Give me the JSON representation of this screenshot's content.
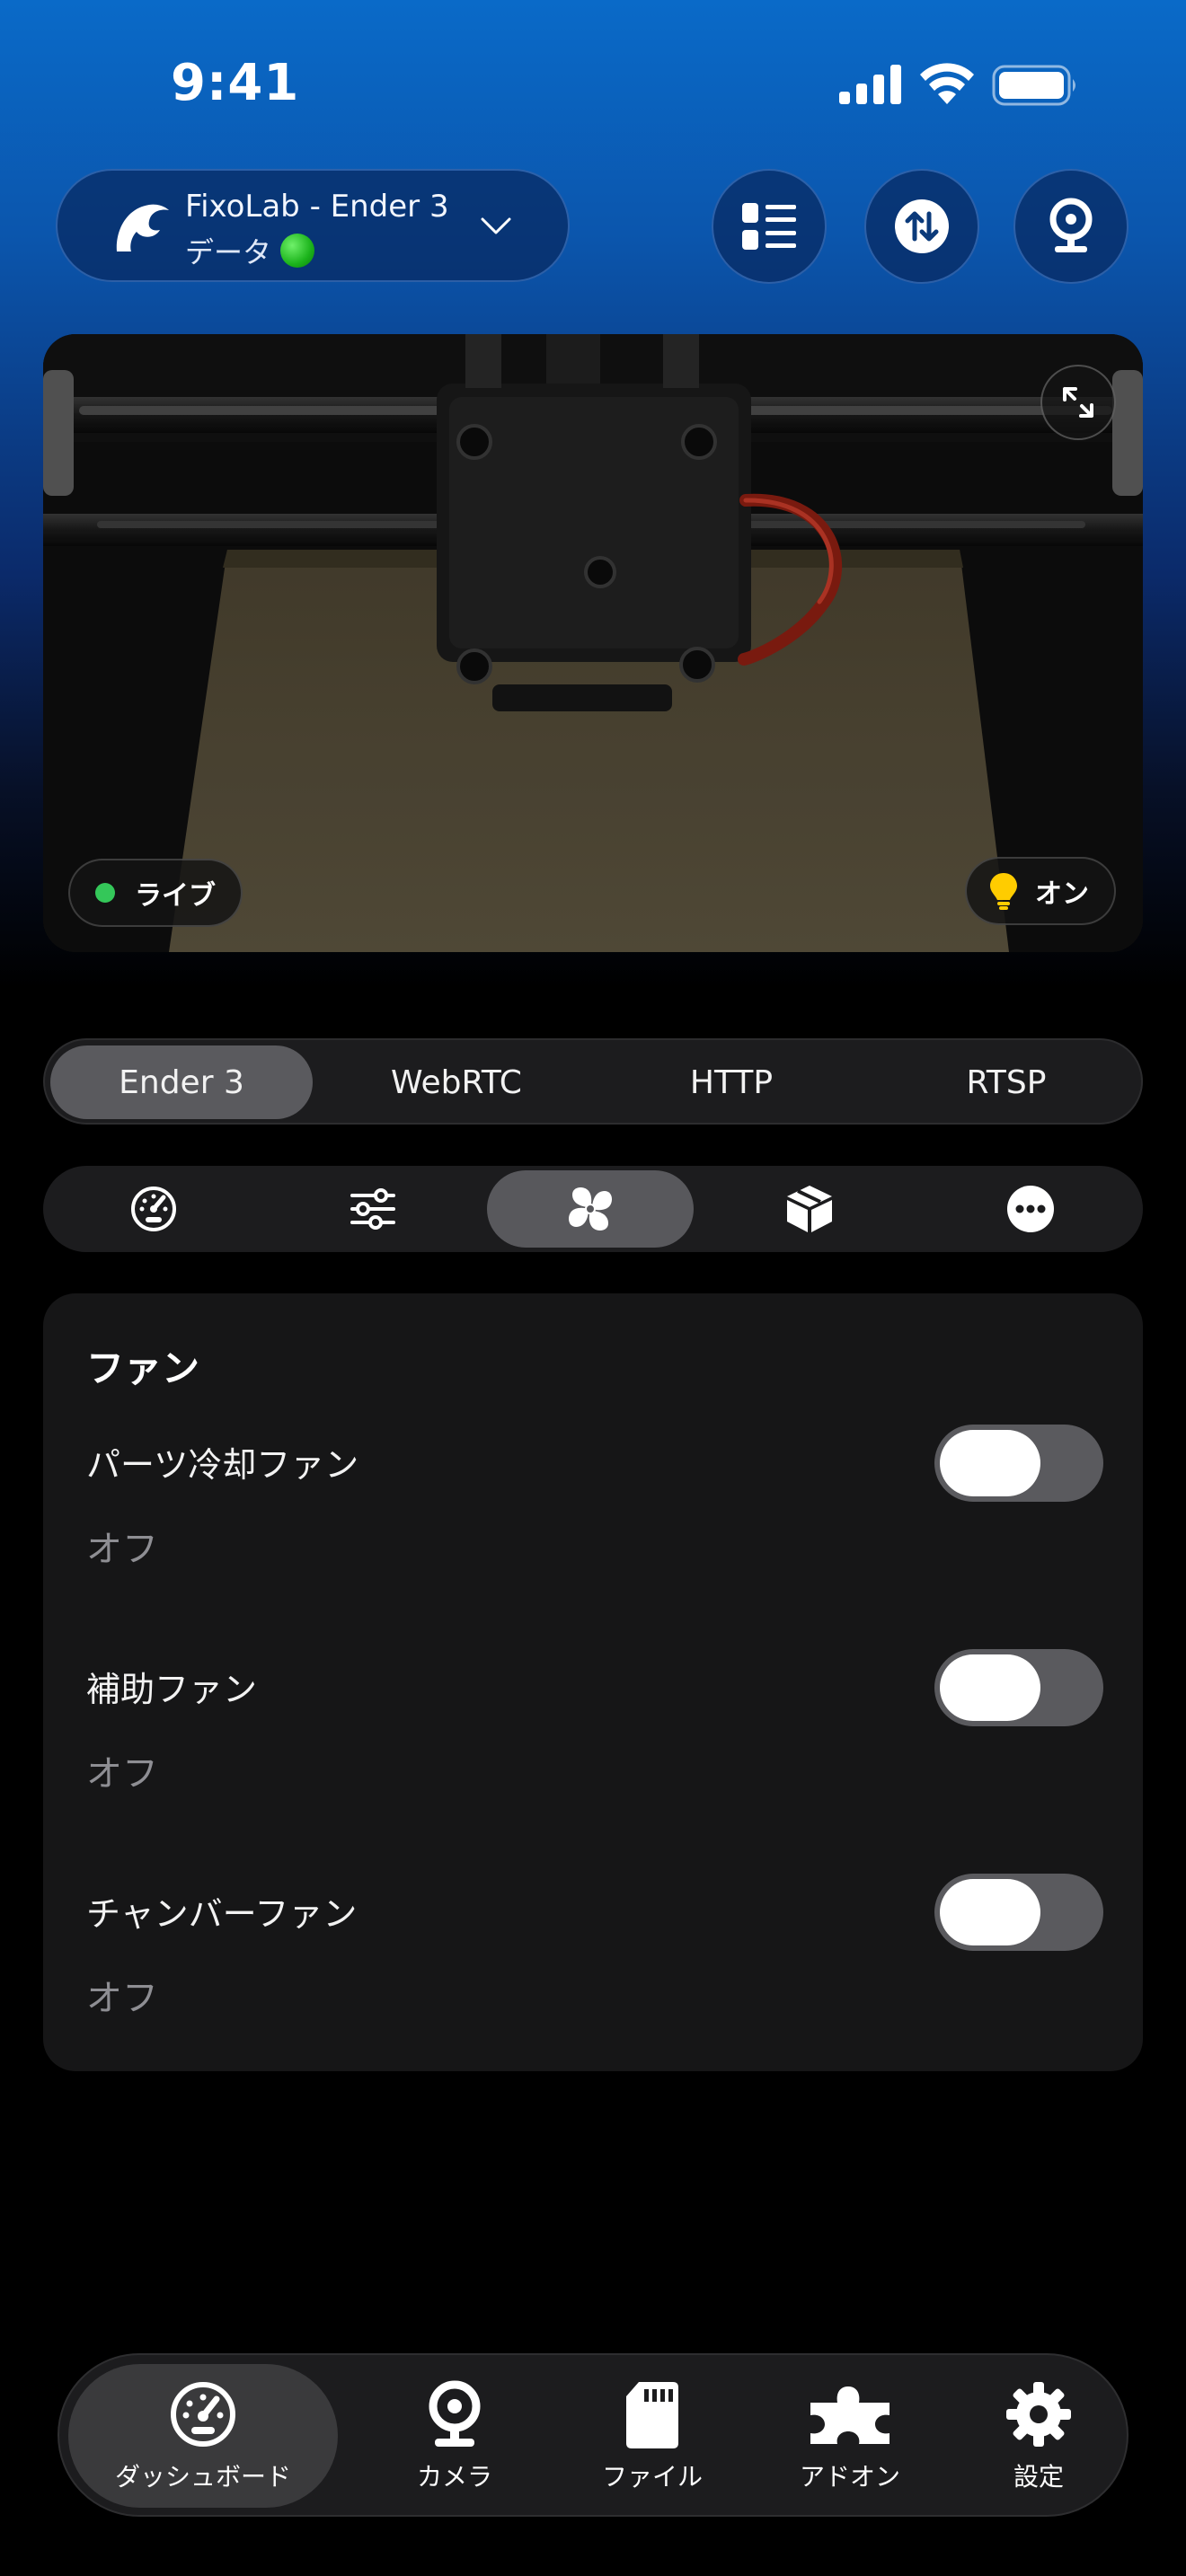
{
  "status_bar": {
    "time": "9:41"
  },
  "header": {
    "printer_name": "FixoLab - Ender 3",
    "printer_subtitle": "データ",
    "status_color": "#2bc22b"
  },
  "camera": {
    "live_label": "ライブ",
    "light_label": "オン"
  },
  "stream_tabs": [
    {
      "label": "Ender 3",
      "active": true
    },
    {
      "label": "WebRTC",
      "active": false
    },
    {
      "label": "HTTP",
      "active": false
    },
    {
      "label": "RTSP",
      "active": false
    }
  ],
  "control_tabs": [
    {
      "icon": "dashboard-gauge-icon",
      "active": false
    },
    {
      "icon": "sliders-icon",
      "active": false
    },
    {
      "icon": "fan-icon",
      "active": true
    },
    {
      "icon": "cube-icon",
      "active": false
    },
    {
      "icon": "more-icon",
      "active": false
    }
  ],
  "fans": {
    "title": "ファン",
    "items": [
      {
        "name": "パーツ冷却ファン",
        "state": "オフ",
        "enabled": false
      },
      {
        "name": "補助ファン",
        "state": "オフ",
        "enabled": false
      },
      {
        "name": "チャンバーファン",
        "state": "オフ",
        "enabled": false
      }
    ]
  },
  "tabbar": [
    {
      "label": "ダッシュボード",
      "icon": "dashboard-icon",
      "active": true
    },
    {
      "label": "カメラ",
      "icon": "webcam-icon",
      "active": false
    },
    {
      "label": "ファイル",
      "icon": "sd-card-icon",
      "active": false
    },
    {
      "label": "アドオン",
      "icon": "puzzle-icon",
      "active": false
    },
    {
      "label": "設定",
      "icon": "gear-icon",
      "active": false
    }
  ]
}
